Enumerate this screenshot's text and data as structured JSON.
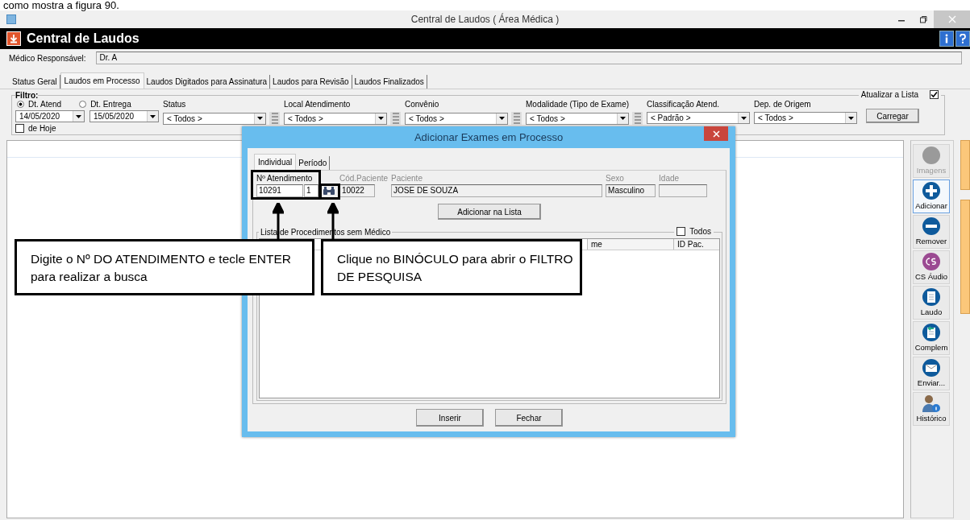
{
  "doc_caption": "como mostra a figura 90.",
  "window": {
    "title": "Central de Laudos ( Área Médica )"
  },
  "header": {
    "title": "Central de Laudos"
  },
  "doctor": {
    "label": "Médico Responsável:",
    "value": "Dr. A"
  },
  "tabs": [
    {
      "label": "Status Geral",
      "selected": false
    },
    {
      "label": "Laudos em Processo",
      "selected": true
    },
    {
      "label": "Laudos Digitados para Assinatura",
      "selected": false
    },
    {
      "label": "Laudos para Revisão",
      "selected": false
    },
    {
      "label": "Laudos Finalizados",
      "selected": false
    }
  ],
  "filter": {
    "title": "Filtro:",
    "date_modes": [
      {
        "label": "Dt. Atend",
        "selected": true
      },
      {
        "label": "Dt. Entrega",
        "selected": false
      }
    ],
    "dates": [
      "14/05/2020",
      "15/05/2020"
    ],
    "today": {
      "label": "de Hoje",
      "checked": false
    },
    "combos": [
      {
        "label": "Status",
        "value": "< Todos >",
        "list_button": true
      },
      {
        "label": "Local Atendimento",
        "value": "<  Todos  >",
        "list_button": true
      },
      {
        "label": "Convênio",
        "value": "< Todos >",
        "list_button": true
      },
      {
        "label": "Modalidade (Tipo de Exame)",
        "value": "<  Todos  >",
        "list_button": true
      },
      {
        "label": "Classificação Atend.",
        "value": "< Padrão >",
        "list_button": false
      },
      {
        "label": "Dep. de Origem",
        "value": "<  Todos  >",
        "list_button": false
      }
    ],
    "refresh": {
      "label": "Atualizar a Lista",
      "checked": true
    },
    "load_button": "Carregar"
  },
  "toolbar": [
    {
      "label": "Imagens",
      "kind": "circle",
      "disabled": true,
      "selected": false
    },
    {
      "label": "Adicionar",
      "kind": "plus",
      "disabled": false,
      "selected": true
    },
    {
      "label": "Remover",
      "kind": "minus",
      "disabled": false,
      "selected": false
    },
    {
      "label": "CS Áudio",
      "kind": "cs",
      "disabled": false,
      "selected": false
    },
    {
      "label": "Laudo",
      "kind": "document",
      "disabled": false,
      "selected": false
    },
    {
      "label": "Complem",
      "kind": "document-arrow",
      "disabled": false,
      "selected": false
    },
    {
      "label": "Enviar...",
      "kind": "envelope",
      "disabled": false,
      "selected": false
    },
    {
      "label": "Histórico",
      "kind": "person",
      "disabled": false,
      "selected": false
    }
  ],
  "dialog": {
    "title": "Adicionar Exames em Processo",
    "tabs": [
      {
        "label": "Individual",
        "selected": true
      },
      {
        "label": "Período",
        "selected": false
      }
    ],
    "fields": [
      {
        "label": "Nº Atendimento",
        "kind": "atendimento",
        "disabled": false,
        "value": "10291",
        "value_2": "1"
      },
      {
        "label": "Cód.Paciente",
        "kind": "text",
        "disabled": true,
        "value": "10022"
      },
      {
        "label": "Paciente",
        "kind": "wide",
        "disabled": true,
        "value": "JOSE DE SOUZA"
      },
      {
        "label": "Sexo",
        "kind": "text",
        "disabled": true,
        "value": "Masculino"
      },
      {
        "label": "Idade",
        "kind": "text",
        "disabled": true
      }
    ],
    "add_button": "Adicionar na Lista",
    "list": {
      "title": "Lista de Procedimentos sem Médico",
      "all": {
        "label": "Todos",
        "checked": false
      },
      "columns": [
        "me",
        "ID Pac."
      ]
    },
    "buttons": [
      "Inserir",
      "Fechar"
    ]
  },
  "callouts": [
    "Digite o Nº DO ATENDIMENTO e tecle ENTER para realizar a busca",
    "Clique no BINÓCULO para abrir o FILTRO DE PESQUISA"
  ]
}
